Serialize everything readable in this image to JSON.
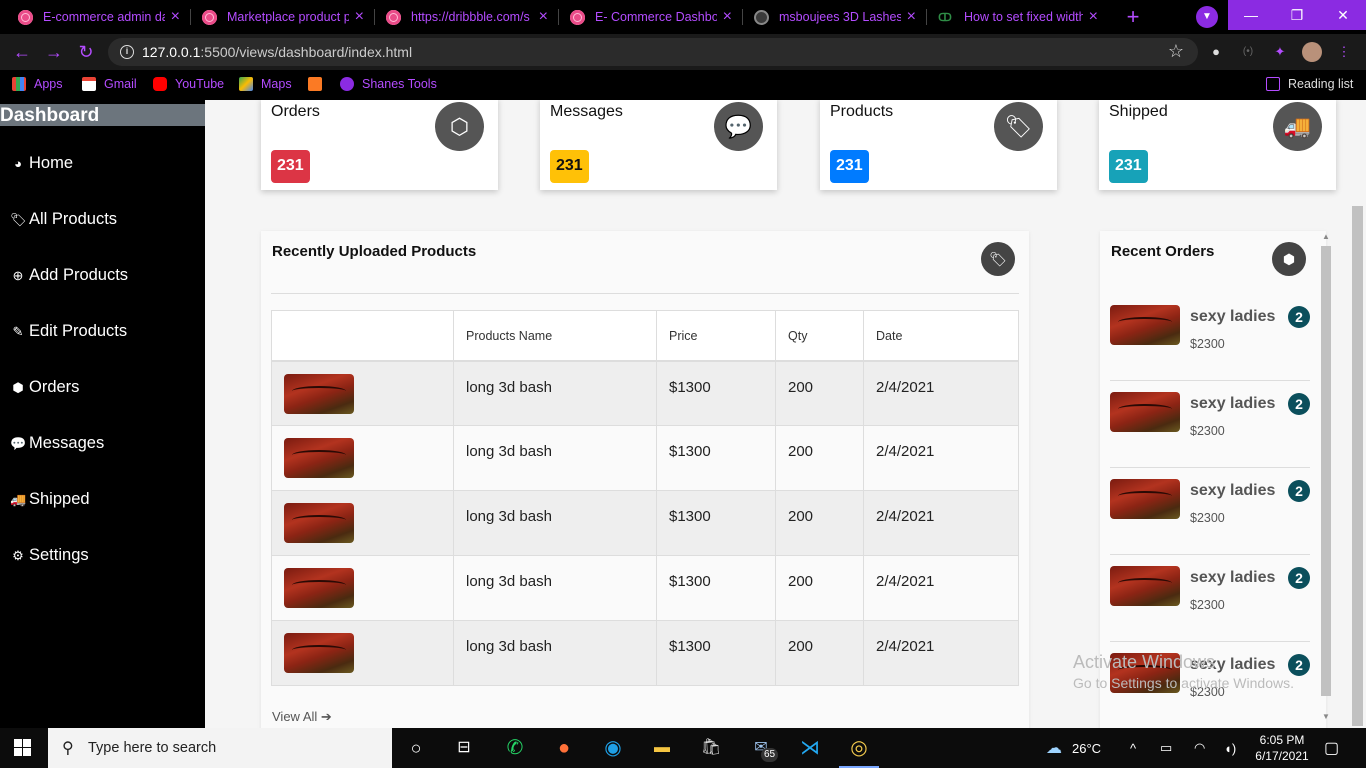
{
  "browser": {
    "tabs": [
      {
        "title": "E-commerce admin da",
        "icon": "dribbble-icon"
      },
      {
        "title": "Marketplace product p",
        "icon": "dribbble-icon"
      },
      {
        "title": "https://dribbble.com/s",
        "icon": "dribbble-icon"
      },
      {
        "title": "E- Commerce Dashbo",
        "icon": "dribbble-icon"
      },
      {
        "title": "msboujees 3D Lashes",
        "icon": "globe-icon"
      },
      {
        "title": "How to set fixed width",
        "icon": "gfg-icon"
      }
    ],
    "url_host": "127.0.0.1",
    "url_rest": ":5500/views/dashboard/index.html",
    "bookmarks": [
      "Apps",
      "Gmail",
      "YouTube",
      "Maps",
      "Shanes Tools"
    ],
    "reading_list": "Reading list",
    "accent": "#b44cff"
  },
  "sidebar": {
    "title": "Dashboard",
    "items": [
      {
        "label": "Home",
        "icon": "dashboard-icon",
        "glyph": "◕"
      },
      {
        "label": "All Products",
        "icon": "tag-icon",
        "glyph": "🏷"
      },
      {
        "label": "Add Products",
        "icon": "plus-circle-icon",
        "glyph": "⊕"
      },
      {
        "label": "Edit Products",
        "icon": "edit-icon",
        "glyph": "✎"
      },
      {
        "label": "Orders",
        "icon": "box-icon",
        "glyph": "⬢"
      },
      {
        "label": "Messages",
        "icon": "comments-icon",
        "glyph": "💬"
      },
      {
        "label": "Shipped",
        "icon": "truck-icon",
        "glyph": "🚚"
      },
      {
        "label": "Settings",
        "icon": "gear-icon",
        "glyph": "⚙"
      }
    ]
  },
  "stats": [
    {
      "label": "Orders",
      "value": "231",
      "color": "#dc3545",
      "icon": "box-icon",
      "glyph": "⬡"
    },
    {
      "label": "Messages",
      "value": "231",
      "color": "#ffc107",
      "icon": "comments-icon",
      "glyph": "💬"
    },
    {
      "label": "Products",
      "value": "231",
      "color": "#007bff",
      "icon": "tag-icon",
      "glyph": "🏷"
    },
    {
      "label": "Shipped",
      "value": "231",
      "color": "#17a2b8",
      "icon": "truck-icon",
      "glyph": "🚚"
    }
  ],
  "recent_products": {
    "title": "Recently Uploaded Products",
    "columns": [
      "",
      "Products Name",
      "Price",
      "Qty",
      "Date"
    ],
    "rows": [
      {
        "name": "long 3d bash",
        "price": "$1300",
        "qty": "200",
        "date": "2/4/2021"
      },
      {
        "name": "long 3d bash",
        "price": "$1300",
        "qty": "200",
        "date": "2/4/2021"
      },
      {
        "name": "long 3d bash",
        "price": "$1300",
        "qty": "200",
        "date": "2/4/2021"
      },
      {
        "name": "long 3d bash",
        "price": "$1300",
        "qty": "200",
        "date": "2/4/2021"
      },
      {
        "name": "long 3d bash",
        "price": "$1300",
        "qty": "200",
        "date": "2/4/2021"
      }
    ],
    "view_all": "View All"
  },
  "recent_orders": {
    "title": "Recent Orders",
    "items": [
      {
        "name": "sexy ladies",
        "price": "$2300",
        "count": "2"
      },
      {
        "name": "sexy ladies",
        "price": "$2300",
        "count": "2"
      },
      {
        "name": "sexy ladies",
        "price": "$2300",
        "count": "2"
      },
      {
        "name": "sexy ladies",
        "price": "$2300",
        "count": "2"
      },
      {
        "name": "sexy ladies",
        "price": "$2300",
        "count": "2"
      }
    ]
  },
  "watermark": {
    "line1": "Activate Windows",
    "line2": "Go to Settings to activate Windows."
  },
  "taskbar": {
    "search_placeholder": "Type here to search",
    "mail_badge": "65",
    "weather": "26°C",
    "time": "6:05 PM",
    "date": "6/17/2021"
  }
}
